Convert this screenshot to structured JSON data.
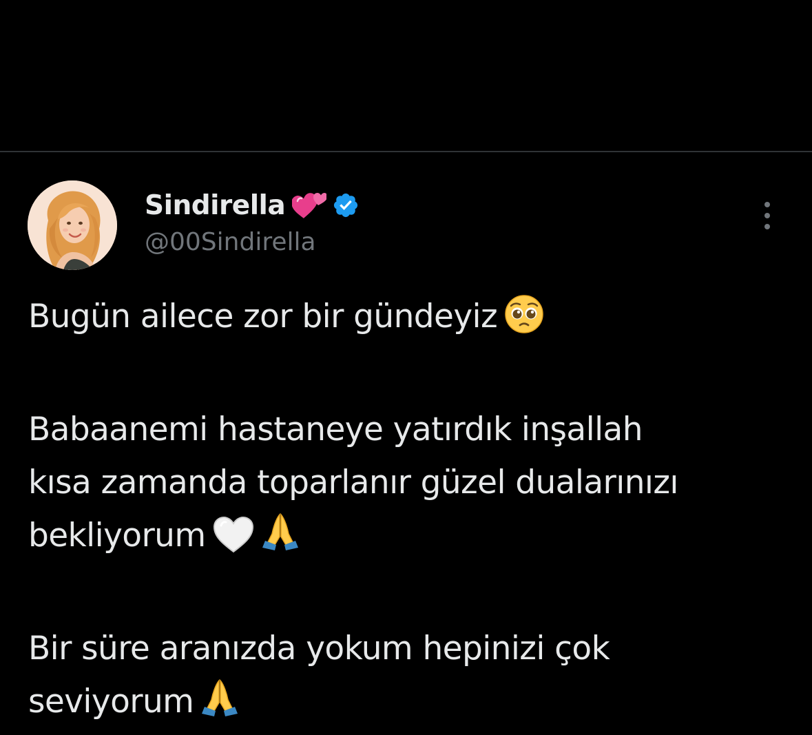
{
  "tweet": {
    "author": {
      "display_name": "Sindirella",
      "name_emoji": "two-hearts-icon",
      "verified_badge": "verified-icon",
      "verified_color": "#1d9bf0",
      "handle": "@00Sindirella"
    },
    "more_menu_icon": "more-vertical-icon",
    "paragraphs": [
      {
        "lines": [
          "Bugün ailece zor bir gündeyiz"
        ],
        "emojis": [
          "pleading-face-icon"
        ]
      },
      {
        "lines": [
          "Babaanemi hastaneye yatırdık inşallah",
          "kısa zamanda toparlanır güzel dualarınızı",
          "bekliyorum"
        ],
        "emojis": [
          "white-heart-icon",
          "folded-hands-icon"
        ]
      },
      {
        "lines": [
          "Bir süre aranızda yokum hepinizi çok",
          "seviyorum"
        ],
        "emojis": [
          "folded-hands-icon"
        ]
      }
    ]
  },
  "colors": {
    "background": "#000000",
    "text_primary": "#e7e9ea",
    "text_secondary": "#71767b",
    "divider": "#2f3336"
  }
}
